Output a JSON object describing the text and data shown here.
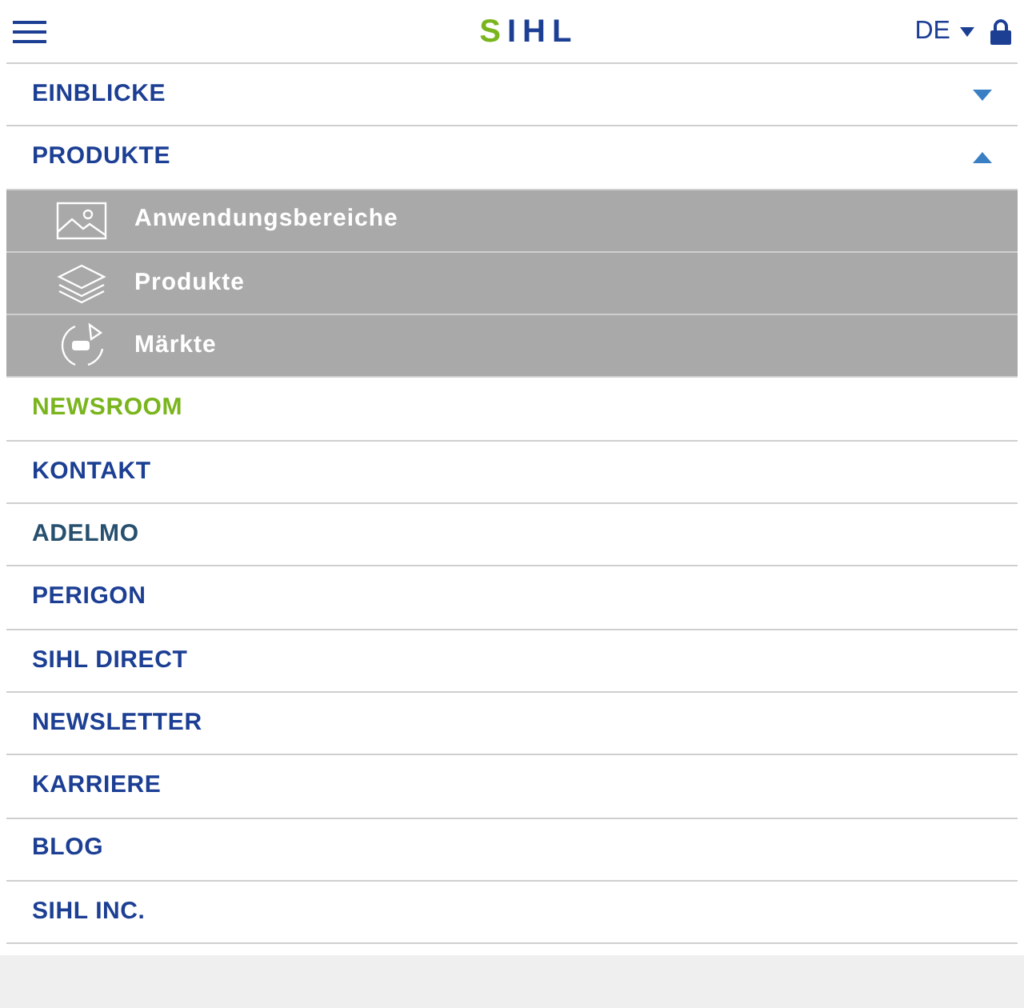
{
  "header": {
    "logo": {
      "first": "S",
      "rest": "IHL"
    },
    "language": "DE"
  },
  "menu": [
    {
      "label": "EINBLICKE",
      "selected": false,
      "expanded": false,
      "color": "#1c3f94"
    },
    {
      "label": "PRODUKTE",
      "selected": false,
      "expanded": true,
      "color": "#1c3f94",
      "children": [
        {
          "label": "Anwendungsbereiche",
          "kind": "image"
        },
        {
          "label": "Produkte",
          "kind": "layers"
        },
        {
          "label": "Märkte",
          "kind": "cycle"
        }
      ]
    },
    {
      "label": "NEWSROOM",
      "selected": true
    },
    {
      "label": "KONTAKT",
      "selected": false,
      "color": "#1c3f94"
    },
    {
      "label": "ADELMO",
      "selected": false,
      "color": "#27506f"
    },
    {
      "label": "PERIGON",
      "selected": false,
      "color": "#1c3f94"
    },
    {
      "label": "SIHL DIRECT",
      "selected": false,
      "color": "#1c3f94"
    },
    {
      "label": "NEWSLETTER",
      "selected": false,
      "color": "#1c3f94"
    },
    {
      "label": "KARRIERE",
      "selected": false,
      "color": "#1c3f94"
    },
    {
      "label": "BLOG",
      "selected": false,
      "color": "#1c3f94"
    },
    {
      "label": "SIHL INC.",
      "selected": false,
      "color": "#1c3f94"
    }
  ]
}
